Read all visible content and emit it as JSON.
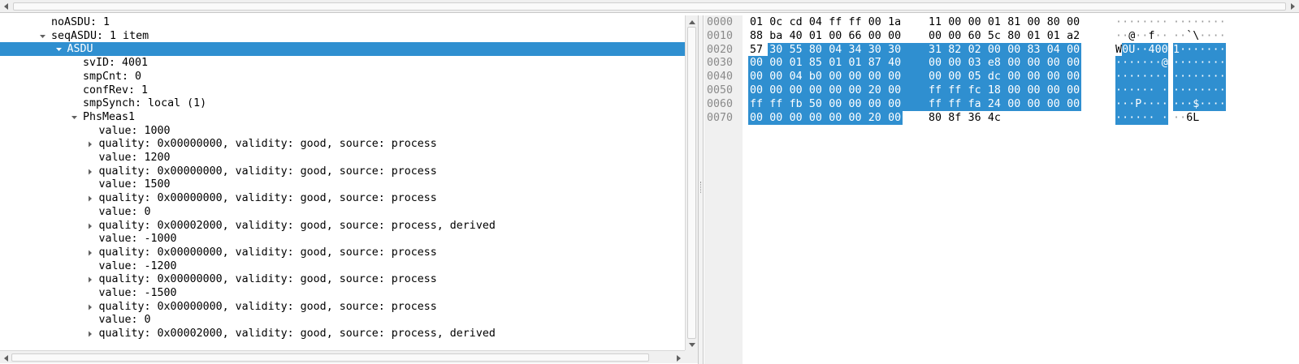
{
  "tree": {
    "rows": [
      {
        "label": "noASDU: 1",
        "indent": 0,
        "expander": "none"
      },
      {
        "label": "seqASDU: 1 item",
        "indent": 0,
        "expander": "expanded"
      },
      {
        "label": "ASDU",
        "indent": 1,
        "expander": "expanded",
        "selected": true
      },
      {
        "label": "svID: 4001",
        "indent": 2,
        "expander": "none"
      },
      {
        "label": "smpCnt: 0",
        "indent": 2,
        "expander": "none"
      },
      {
        "label": "confRev: 1",
        "indent": 2,
        "expander": "none"
      },
      {
        "label": "smpSynch: local (1)",
        "indent": 2,
        "expander": "none"
      },
      {
        "label": "PhsMeas1",
        "indent": 2,
        "expander": "expanded"
      },
      {
        "label": "value: 1000",
        "indent": 3,
        "expander": "none"
      },
      {
        "label": "quality: 0x00000000, validity: good, source: process",
        "indent": 3,
        "expander": "collapsed"
      },
      {
        "label": "value: 1200",
        "indent": 3,
        "expander": "none"
      },
      {
        "label": "quality: 0x00000000, validity: good, source: process",
        "indent": 3,
        "expander": "collapsed"
      },
      {
        "label": "value: 1500",
        "indent": 3,
        "expander": "none"
      },
      {
        "label": "quality: 0x00000000, validity: good, source: process",
        "indent": 3,
        "expander": "collapsed"
      },
      {
        "label": "value: 0",
        "indent": 3,
        "expander": "none"
      },
      {
        "label": "quality: 0x00002000, validity: good, source: process, derived",
        "indent": 3,
        "expander": "collapsed"
      },
      {
        "label": "value: -1000",
        "indent": 3,
        "expander": "none"
      },
      {
        "label": "quality: 0x00000000, validity: good, source: process",
        "indent": 3,
        "expander": "collapsed"
      },
      {
        "label": "value: -1200",
        "indent": 3,
        "expander": "none"
      },
      {
        "label": "quality: 0x00000000, validity: good, source: process",
        "indent": 3,
        "expander": "collapsed"
      },
      {
        "label": "value: -1500",
        "indent": 3,
        "expander": "none"
      },
      {
        "label": "quality: 0x00000000, validity: good, source: process",
        "indent": 3,
        "expander": "collapsed"
      },
      {
        "label": "value: 0",
        "indent": 3,
        "expander": "none"
      },
      {
        "label": "quality: 0x00002000, validity: good, source: process, derived",
        "indent": 3,
        "expander": "collapsed"
      }
    ]
  },
  "bytes": {
    "rows": [
      {
        "offset": "0000",
        "hex1": "01 0c cd 04 ff ff 00 1a",
        "hex2": "11 00 00 01 81 00 80 00",
        "ascii1": "········",
        "ascii2": "········",
        "sel_from": 16,
        "sel_to": 16
      },
      {
        "offset": "0010",
        "hex1": "88 ba 40 01 00 66 00 00",
        "hex2": "00 00 60 5c 80 01 01 a2",
        "ascii1": "··@··f··",
        "ascii2": "··`\\····",
        "sel_from": 16,
        "sel_to": 16
      },
      {
        "offset": "0020",
        "hex1": "57 30 55 80 04 34 30 30",
        "hex2": "31 82 02 00 00 83 04 00",
        "ascii1": "W0U··400",
        "ascii2": "1·······",
        "sel_from": 1,
        "sel_to": 16
      },
      {
        "offset": "0030",
        "hex1": "00 00 01 85 01 01 87 40",
        "hex2": "00 00 03 e8 00 00 00 00",
        "ascii1": "·······@",
        "ascii2": "········",
        "sel_from": 0,
        "sel_to": 16
      },
      {
        "offset": "0040",
        "hex1": "00 00 04 b0 00 00 00 00",
        "hex2": "00 00 05 dc 00 00 00 00",
        "ascii1": "········",
        "ascii2": "········",
        "sel_from": 0,
        "sel_to": 16
      },
      {
        "offset": "0050",
        "hex1": "00 00 00 00 00 00 20 00",
        "hex2": "ff ff fc 18 00 00 00 00",
        "ascii1": "······ ·",
        "ascii2": "········",
        "sel_from": 0,
        "sel_to": 16
      },
      {
        "offset": "0060",
        "hex1": "ff ff fb 50 00 00 00 00",
        "hex2": "ff ff fa 24 00 00 00 00",
        "ascii1": "···P····",
        "ascii2": "···$····",
        "sel_from": 0,
        "sel_to": 16
      },
      {
        "offset": "0070",
        "hex1": "00 00 00 00 00 00 20 00",
        "hex2": "80 8f 36 4c",
        "ascii1": "······ ·",
        "ascii2": "··6L",
        "sel_from": 0,
        "sel_to": 8
      }
    ]
  },
  "colors": {
    "selection": "#2f8fd0",
    "offset_text": "#8a8a8a",
    "pane_gray": "#f0f0f0"
  }
}
